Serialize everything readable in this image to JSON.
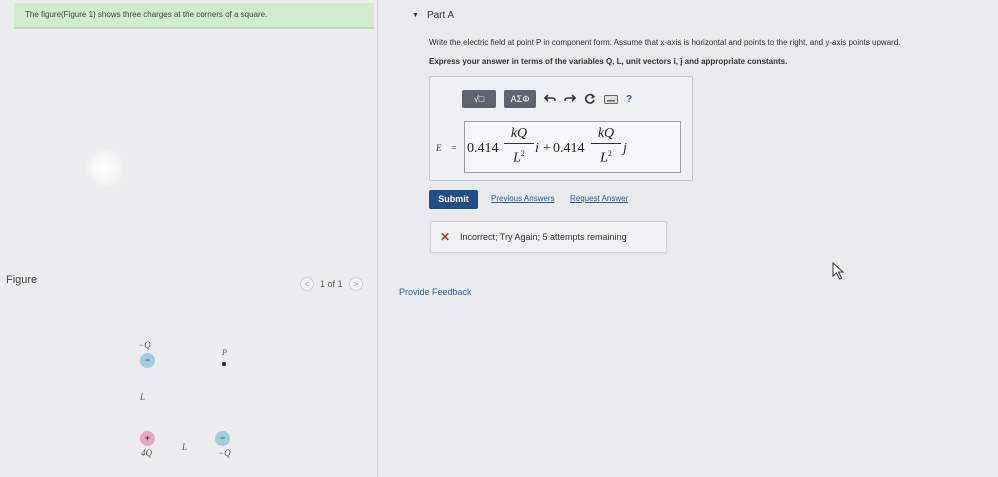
{
  "intro": {
    "text": "The figure(Figure 1) shows three charges at the corners of a square."
  },
  "figure_panel": {
    "label": "Figure",
    "pager_text": "1 of 1",
    "prev_arrow": "<",
    "next_arrow": ">",
    "diagram": {
      "top_charge_label": "−Q",
      "top_charge_sign": "−",
      "point_label": "P",
      "side_label": "L",
      "bottom_left_label": "4Q",
      "bottom_left_sign": "+",
      "bottom_side_label": "L",
      "bottom_right_label": "−Q",
      "bottom_right_sign": "−",
      "colors": {
        "negative": "#9ccfdc",
        "positive": "#e7a8c4"
      }
    }
  },
  "part": {
    "caret_icon": "caret-down-icon",
    "title": "Part A",
    "question": "Write the electric field at point P in component form. Assume that x-axis is horizontal and points to the right, and y-axis points upward.",
    "instruction": "Express your answer in terms of the variables Q, L, unit vectors î, ĵ and appropriate constants."
  },
  "toolbar": {
    "templates_label": "√□",
    "greek_label": "ΑΣΦ",
    "undo_icon": "undo-icon",
    "redo_icon": "redo-icon",
    "reset_icon": "reset-icon",
    "keyboard_icon": "keyboard-icon",
    "help_label": "?"
  },
  "answer": {
    "lhs": "E⃗ =",
    "coef1": "0.414",
    "frac1_num": "kQ",
    "frac1_den": "L",
    "frac1_den_exp": "2",
    "unit1": "i",
    "plus": "+",
    "coef2": "0.414",
    "frac2_num": "kQ",
    "frac2_den": "L",
    "frac2_den_exp": "2",
    "unit2": "j"
  },
  "actions": {
    "submit": "Submit",
    "previous_answers": "Previous Answers",
    "request_answer": "Request Answer"
  },
  "feedback": {
    "icon": "x-icon",
    "text": "Incorrect; Try Again; 5 attempts remaining",
    "color": "#c0392b"
  },
  "provide_feedback": "Provide Feedback"
}
